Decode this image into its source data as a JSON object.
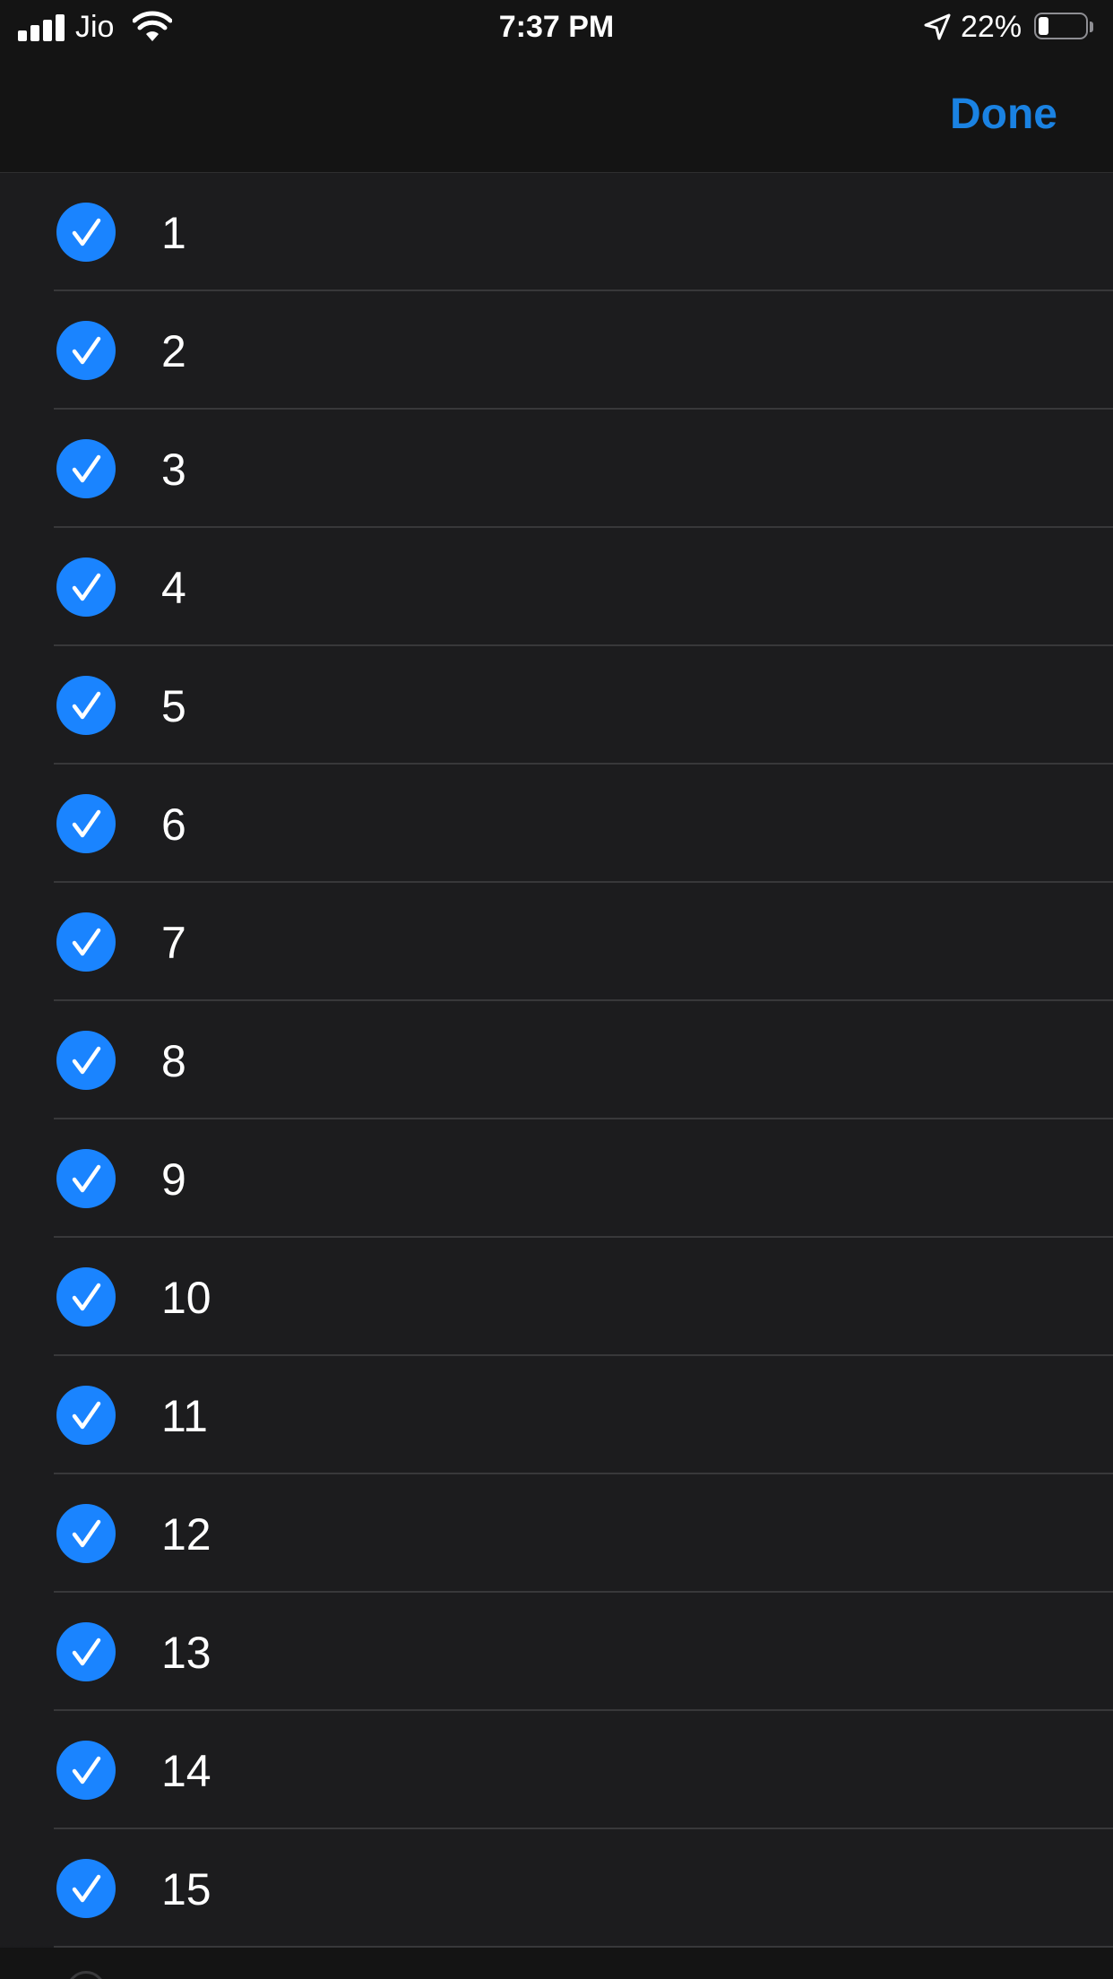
{
  "status_bar": {
    "carrier": "Jio",
    "time": "7:37 PM",
    "battery_percent_label": "22%",
    "battery_level": 0.22,
    "signal_bars": 4,
    "icons": [
      "signal-icon",
      "wifi-icon",
      "location-arrow-icon",
      "battery-icon"
    ]
  },
  "nav": {
    "done_label": "Done"
  },
  "list": {
    "items": [
      {
        "label": "1",
        "checked": true
      },
      {
        "label": "2",
        "checked": true
      },
      {
        "label": "3",
        "checked": true
      },
      {
        "label": "4",
        "checked": true
      },
      {
        "label": "5",
        "checked": true
      },
      {
        "label": "6",
        "checked": true
      },
      {
        "label": "7",
        "checked": true
      },
      {
        "label": "8",
        "checked": true
      },
      {
        "label": "9",
        "checked": true
      },
      {
        "label": "10",
        "checked": true
      },
      {
        "label": "11",
        "checked": true
      },
      {
        "label": "12",
        "checked": true
      },
      {
        "label": "13",
        "checked": true
      },
      {
        "label": "14",
        "checked": true
      },
      {
        "label": "15",
        "checked": true
      }
    ]
  },
  "colors": {
    "accent": "#1a82e2",
    "checkmark_fill": "#1a84ff",
    "background": "#1c1c1e",
    "separator": "#38383a"
  }
}
